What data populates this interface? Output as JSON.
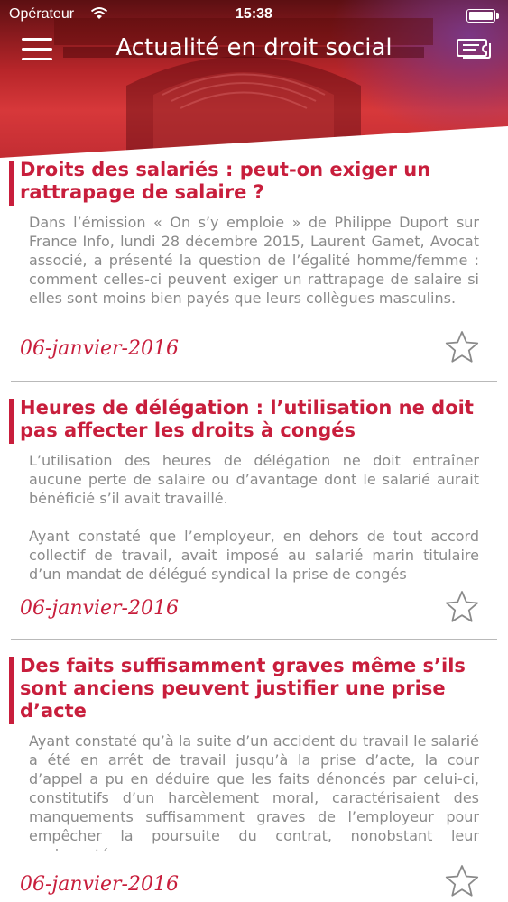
{
  "status_bar": {
    "carrier": "Opérateur",
    "time": "15:38"
  },
  "header": {
    "title": "Actualité en droit social"
  },
  "colors": {
    "accent": "#c81e3c",
    "body_text": "#8a8a8a",
    "divider": "#b9b9b9"
  },
  "articles": [
    {
      "title": "Droits des salariés : peut-on exiger un rattrapage de salaire ?",
      "paragraphs": [
        "Dans l’émission « On s’y emploie » de Philippe Duport sur France Info, lundi 28 décembre 2015, Laurent Gamet, Avocat associé, a présenté la question de l’égalité homme/femme : comment celles-ci peuvent exiger un rattrapage de salaire si elles sont moins bien payés que leurs collègues masculins."
      ],
      "date": "06-janvier-2016",
      "star_icon": "star-outline-icon"
    },
    {
      "title": "Heures de délégation : l’utilisation ne doit pas affecter les droits à congés",
      "paragraphs": [
        "L’utilisation des heures de délégation ne doit entraîner aucune perte de salaire ou d’avantage dont le salarié aurait bénéficié s’il avait travaillé.",
        "Ayant constaté que l’employeur, en dehors de tout accord collectif de travail, avait imposé au salarié marin titulaire d’un mandat de délégué syndical la prise de congés"
      ],
      "date": "06-janvier-2016",
      "star_icon": "star-outline-icon"
    },
    {
      "title": "Des faits suffisamment graves même s’ils sont anciens peuvent justifier une prise d’acte",
      "paragraphs": [
        "Ayant constaté qu’à la suite d’un accident du travail le salarié a été en arrêt de travail jusqu’à la prise d’acte, la cour d’appel a pu en déduire que les faits dénoncés par celui-ci, constitutifs d’un harcèlement moral, caractérisaient des manquements suffisamment graves de l’employeur pour empêcher la poursuite du contrat, nonobstant leur ancienneté."
      ],
      "date": "06-janvier-2016",
      "star_icon": "star-outline-icon"
    }
  ]
}
